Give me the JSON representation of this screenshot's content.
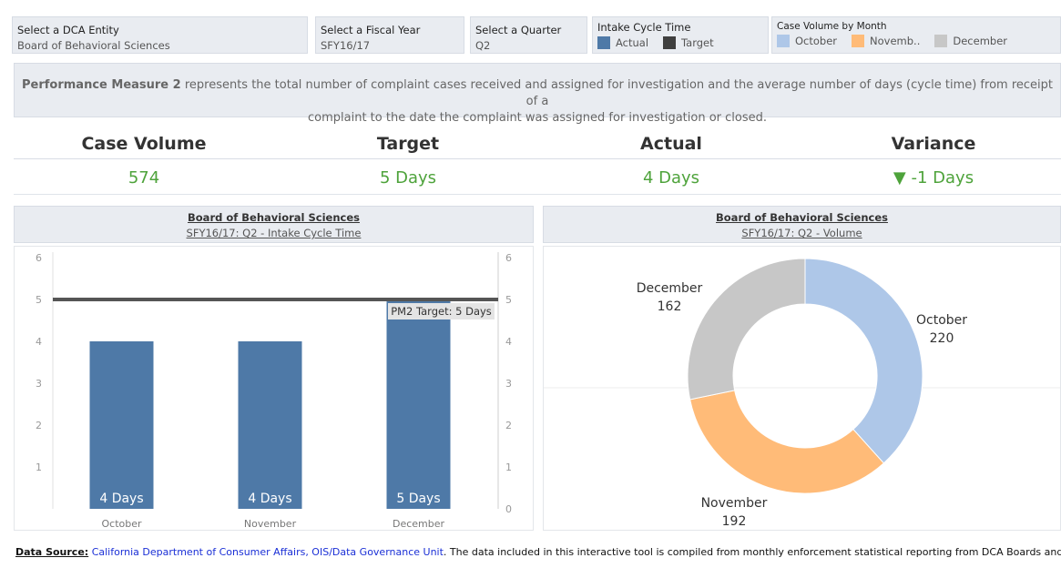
{
  "filters": {
    "entity": {
      "label": "Select a DCA Entity",
      "value": "Board of Behavioral Sciences"
    },
    "fiscal_year": {
      "label": "Select a Fiscal Year",
      "value": "SFY16/17"
    },
    "quarter": {
      "label": "Select a Quarter",
      "value": "Q2"
    },
    "intake_legend": {
      "label": "Intake Cycle Time",
      "items": [
        {
          "name": "Actual",
          "color": "#4e79a7"
        },
        {
          "name": "Target",
          "color": "#3f3f3f"
        }
      ]
    },
    "volume_legend": {
      "label": "Case Volume by Month",
      "items": [
        {
          "name": "October",
          "color": "#aec7e8"
        },
        {
          "name": "Novemb..",
          "color": "#ffbb78"
        },
        {
          "name": "December",
          "color": "#c7c7c7"
        }
      ]
    }
  },
  "description": {
    "bold": "Performance Measure 2",
    "line1": " represents the total number of complaint cases received and assigned for investigation and the average number of days (cycle time) from receipt of a",
    "line2": "complaint to the date the complaint was assigned for investigation or closed."
  },
  "kpis": {
    "case_volume": {
      "label": "Case Volume",
      "value": "574"
    },
    "target": {
      "label": "Target",
      "value": "5 Days"
    },
    "actual": {
      "label": "Actual",
      "value": "4 Days"
    },
    "variance": {
      "label": "Variance",
      "value": "-1 Days",
      "arrow": "▼"
    }
  },
  "left_panel": {
    "title": "Board of Behavioral Sciences",
    "subtitle": "SFY16/17: Q2 -  Intake Cycle Time"
  },
  "right_panel": {
    "title": "Board of Behavioral Sciences",
    "subtitle": "SFY16/17: Q2 - Volume"
  },
  "chart_data": [
    {
      "type": "bar",
      "categories": [
        "October",
        "November",
        "December"
      ],
      "values": [
        4,
        4,
        5
      ],
      "data_labels": [
        "4 Days",
        "4 Days",
        "5 Days"
      ],
      "reference_line": {
        "value": 5,
        "label": "PM2 Target: 5 Days"
      },
      "ylim": [
        0,
        6
      ],
      "yticks": [
        0,
        1,
        2,
        3,
        4,
        5,
        6
      ],
      "bar_color": "#4e79a7",
      "line_color": "#555555"
    },
    {
      "type": "pie",
      "donut": true,
      "labels": [
        "October",
        "November",
        "December"
      ],
      "values": [
        220,
        192,
        162
      ],
      "colors": [
        "#aec7e8",
        "#ffbb78",
        "#c7c7c7"
      ]
    }
  ],
  "footer": {
    "source_label": "Data Source:",
    "source_link": "California Department of Consumer Affairs, OIS/Data Governance Unit",
    "text": ".  The data included in this interactive tool is compiled from monthly enforcement statistical reporting from DCA Boards and Bu"
  }
}
